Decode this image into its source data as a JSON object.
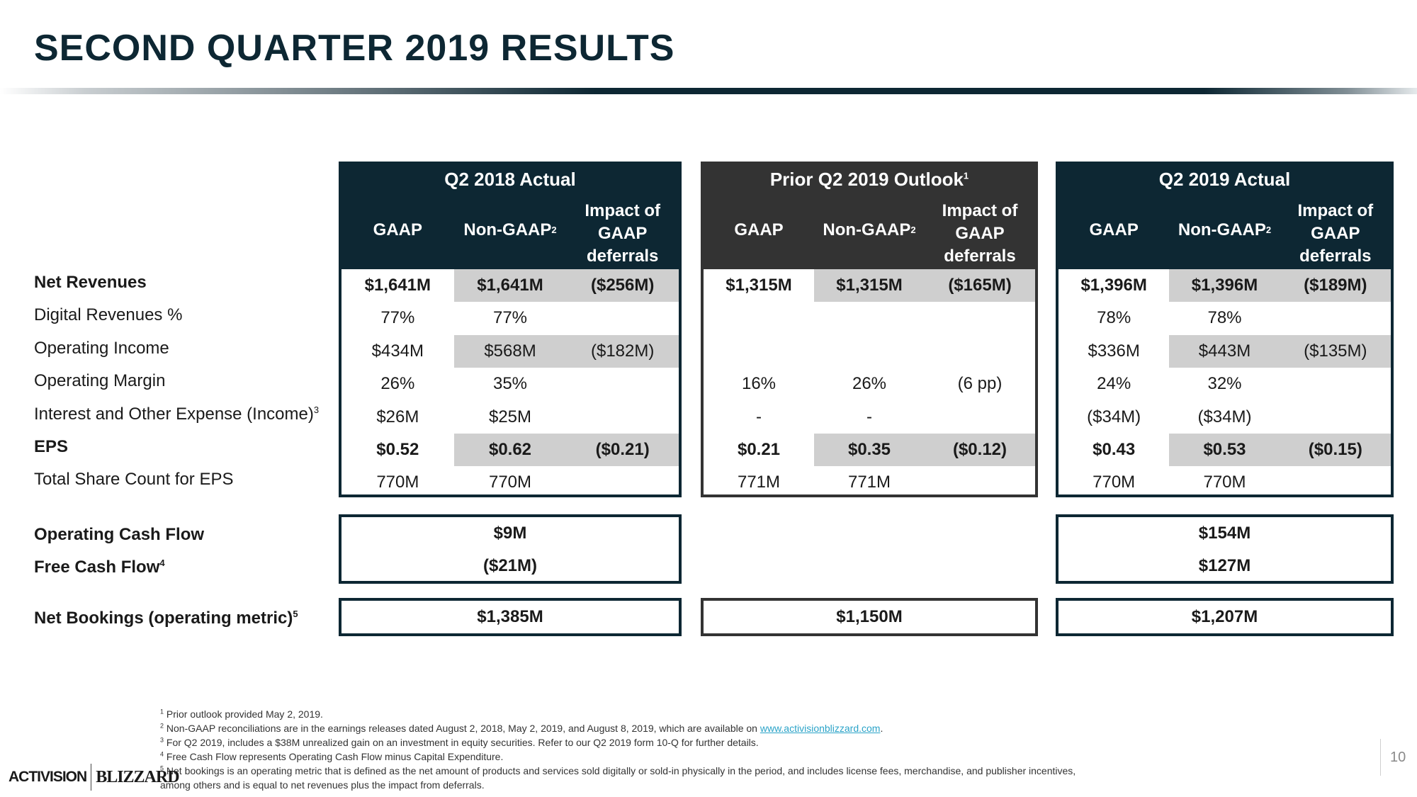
{
  "title": "SECOND QUARTER 2019 RESULTS",
  "row_labels": [
    {
      "text": "Net Revenues",
      "sup": "",
      "bold": true
    },
    {
      "text": "Digital Revenues %",
      "sup": "",
      "bold": false
    },
    {
      "text": "Operating Income",
      "sup": "",
      "bold": false
    },
    {
      "text": "Operating Margin",
      "sup": "",
      "bold": false
    },
    {
      "text": "Interest and Other Expense (Income)",
      "sup": "3",
      "bold": false
    },
    {
      "text": "EPS",
      "sup": "",
      "bold": true
    },
    {
      "text": "Total Share Count for EPS",
      "sup": "",
      "bold": false
    }
  ],
  "cash_labels": [
    {
      "text": "Operating Cash Flow",
      "sup": ""
    },
    {
      "text": "Free Cash Flow",
      "sup": "4"
    }
  ],
  "bookings_label": {
    "text": "Net Bookings (operating metric)",
    "sup": "5"
  },
  "columns": {
    "gaap": "GAAP",
    "nongaap": "Non-GAAP",
    "nongaap_sup": "2",
    "impact_1": "Impact of",
    "impact_2": "GAAP",
    "impact_3": "deferrals"
  },
  "blocks": [
    {
      "title": "Q2 2018 Actual",
      "title_sup": "",
      "rows": [
        [
          "$1,641M",
          "$1,641M",
          "($256M)"
        ],
        [
          "77%",
          "77%",
          ""
        ],
        [
          "$434M",
          "$568M",
          "($182M)"
        ],
        [
          "26%",
          "35%",
          ""
        ],
        [
          "$26M",
          "$25M",
          ""
        ],
        [
          "$0.52",
          "$0.62",
          "($0.21)"
        ],
        [
          "770M",
          "770M",
          ""
        ]
      ],
      "operating_cash_flow": "$9M",
      "free_cash_flow": "($21M)",
      "net_bookings": "$1,385M"
    },
    {
      "title": "Prior Q2 2019 Outlook",
      "title_sup": "1",
      "rows": [
        [
          "$1,315M",
          "$1,315M",
          "($165M)"
        ],
        [
          "",
          "",
          ""
        ],
        [
          "",
          "",
          ""
        ],
        [
          "16%",
          "26%",
          "(6 pp)"
        ],
        [
          "-",
          "-",
          ""
        ],
        [
          "$0.21",
          "$0.35",
          "($0.12)"
        ],
        [
          "771M",
          "771M",
          ""
        ]
      ],
      "net_bookings": "$1,150M"
    },
    {
      "title": "Q2 2019 Actual",
      "title_sup": "",
      "rows": [
        [
          "$1,396M",
          "$1,396M",
          "($189M)"
        ],
        [
          "78%",
          "78%",
          ""
        ],
        [
          "$336M",
          "$443M",
          "($135M)"
        ],
        [
          "24%",
          "32%",
          ""
        ],
        [
          "($34M)",
          "($34M)",
          ""
        ],
        [
          "$0.43",
          "$0.53",
          "($0.15)"
        ],
        [
          "770M",
          "770M",
          ""
        ]
      ],
      "operating_cash_flow": "$154M",
      "free_cash_flow": "$127M",
      "net_bookings": "$1,207M"
    }
  ],
  "footnotes": [
    {
      "num": "1",
      "text": "Prior outlook provided May 2, 2019."
    },
    {
      "num": "2",
      "text": "Non-GAAP reconciliations are in the earnings releases dated August 2, 2018, May 2, 2019, and August 8, 2019, which are available on ",
      "link": "www.activisionblizzard.com",
      "after": "."
    },
    {
      "num": "3",
      "text": "For Q2 2019, includes a $38M unrealized gain on an investment in equity securities. Refer to our Q2 2019 form 10-Q for further details."
    },
    {
      "num": "4",
      "text": "Free Cash Flow represents Operating Cash Flow minus Capital Expenditure."
    },
    {
      "num": "5",
      "text": "Net bookings is an operating metric that is defined as the net amount of products and services sold digitally or sold-in physically in the period, and includes license fees, merchandise, and publisher incentives,"
    },
    {
      "num": "",
      "text": "among others and is equal to net revenues plus the impact from deferrals."
    }
  ],
  "logo": {
    "left": "ACTIVISION",
    "right": "BLIZZARD"
  },
  "page_number": "10",
  "colors": {
    "navy": "#0d2733",
    "charcoal": "#333333",
    "shade": "#cfcfcf",
    "link": "#2aa3c8"
  }
}
